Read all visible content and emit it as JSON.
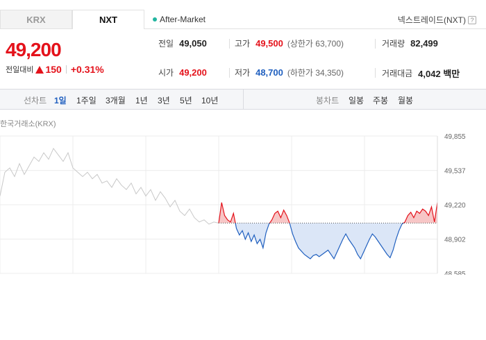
{
  "tabs": [
    {
      "label": "KRX"
    },
    {
      "label": "NXT"
    }
  ],
  "session_label": "After-Market",
  "nextrade_label": "넥스트레이드(NXT)",
  "help_glyph": "?",
  "price": "49,200",
  "change": {
    "label": "전일대비",
    "amount": "150",
    "percent": "+0.31%"
  },
  "info": {
    "prev_close": {
      "label": "전일",
      "value": "49,050"
    },
    "high": {
      "label": "고가",
      "value": "49,500",
      "sub": "(상한가 63,700)"
    },
    "volume": {
      "label": "거래량",
      "value": "82,499"
    },
    "open": {
      "label": "시가",
      "value": "49,200"
    },
    "low": {
      "label": "저가",
      "value": "48,700",
      "sub": "(하한가 34,350)"
    },
    "amount": {
      "label": "거래대금",
      "value": "4,042 백만"
    }
  },
  "toolbar": {
    "line_label": "선차트",
    "periods": [
      "1일",
      "1주일",
      "3개월",
      "1년",
      "3년",
      "5년",
      "10년"
    ],
    "active_period": "1일",
    "candle_label": "봉차트",
    "candles": [
      "일봉",
      "주봉",
      "월봉"
    ]
  },
  "chart_title": "한국거래소(KRX)",
  "colors": {
    "up": "#e4121b",
    "down": "#1f5fbf",
    "gray_line": "#c8c8c8",
    "up_fill": "#f7c6c6",
    "down_fill": "#dbe6f7"
  },
  "chart_data": {
    "type": "line",
    "title": "",
    "baseline": 49050,
    "ylim": [
      48585,
      49855
    ],
    "y_ticks": [
      "49,855",
      "49,537",
      "49,220",
      "48,902",
      "48,585"
    ],
    "y_tick_values": [
      49855,
      49537,
      49220,
      48902,
      48585
    ],
    "series": [
      {
        "values": [
          49300,
          49520,
          49560,
          49480,
          49600,
          49500,
          49580,
          49660,
          49620,
          49700,
          49640,
          49740,
          49680,
          49620,
          49700,
          49560,
          49520,
          49480,
          49520,
          49460,
          49500,
          49420,
          49440,
          49380,
          49460,
          49400,
          49360,
          49420,
          49320,
          49380,
          49300,
          49360,
          49260,
          49340,
          49280,
          49200,
          49260,
          49160,
          49120,
          49180,
          49100,
          49060,
          49080,
          49040,
          49060,
          49050
        ]
      },
      {
        "values": [
          49050,
          49240,
          49120,
          49080,
          49060,
          49140,
          49000,
          48940,
          48980,
          48900,
          48960,
          48880,
          48940,
          48860,
          48900,
          48820,
          48960,
          49040,
          49080,
          49140,
          49160,
          49100,
          49170,
          49120,
          49050,
          48950,
          48880,
          48820,
          48790,
          48760,
          48740,
          48720,
          48750,
          48760,
          48740,
          48760,
          48780,
          48800,
          48760,
          48720,
          48780,
          48840,
          48900,
          48950,
          48900,
          48860,
          48820,
          48760,
          48720,
          48780,
          48840,
          48900,
          48950,
          48920,
          48880,
          48840,
          48800,
          48760,
          48730,
          48800,
          48900,
          48980,
          49040,
          49060,
          49120,
          49150,
          49100,
          49160,
          49140,
          49180,
          49160,
          49120,
          49200,
          49060,
          49240
        ]
      }
    ]
  }
}
